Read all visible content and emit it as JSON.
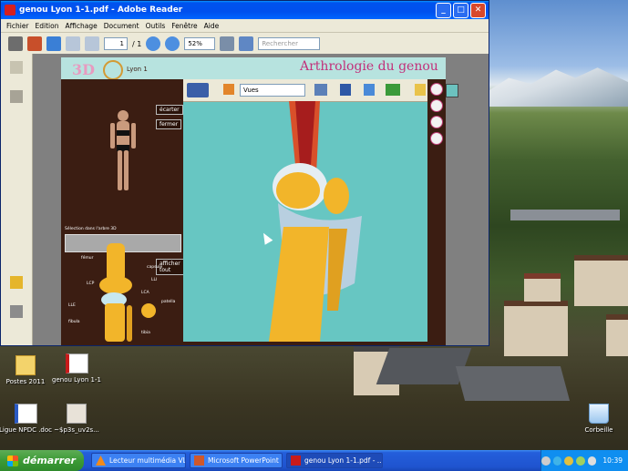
{
  "window": {
    "title": "genou Lyon 1-1.pdf - Adobe Reader",
    "controls": [
      "_",
      "□",
      "✕"
    ]
  },
  "menu": [
    "Fichier",
    "Edition",
    "Affichage",
    "Document",
    "Outils",
    "Fenêtre",
    "Aide"
  ],
  "toolbar": {
    "page_current": "1",
    "page_total": "/ 1",
    "zoom": "52%",
    "search_placeholder": "Rechercher"
  },
  "document": {
    "header_logo": "3D",
    "header_subtitle": "Lyon 1",
    "title": "Arthrologie du genou",
    "buttons": {
      "ecarter": "écarter",
      "fermer": "fermer",
      "afficher_tout": "afficher tout"
    },
    "selection_label": "Sélection dans l'arbre 3D",
    "anatomy_labels": [
      "fémur",
      "capsule",
      "LCP",
      "LLE",
      "LCA",
      "LLI",
      "patella",
      "fibula",
      "tibia"
    ]
  },
  "viewer_toolbar": {
    "view_select": "Vues"
  },
  "desktop": {
    "icons": [
      {
        "label": "Postes 2011"
      },
      {
        "label": "genou Lyon 1-1"
      },
      {
        "label": "Ligue NPDC .doc"
      },
      {
        "label": "~$p3s_uv2s..."
      },
      {
        "label": "Corbeille"
      }
    ]
  },
  "taskbar": {
    "start": "démarrer",
    "tasks": [
      "Lecteur multimédia VLC",
      "Microsoft PowerPoint ...",
      "genou Lyon 1-1.pdf - ..."
    ],
    "clock": "10:39"
  },
  "colors": {
    "xp_blue": "#0050ee",
    "page_brown": "#3b1d12",
    "viewer_teal": "#67c6c2",
    "title_pink": "#c2307a",
    "header_mint": "#b7e3df",
    "bone_yellow": "#f2b52a"
  }
}
